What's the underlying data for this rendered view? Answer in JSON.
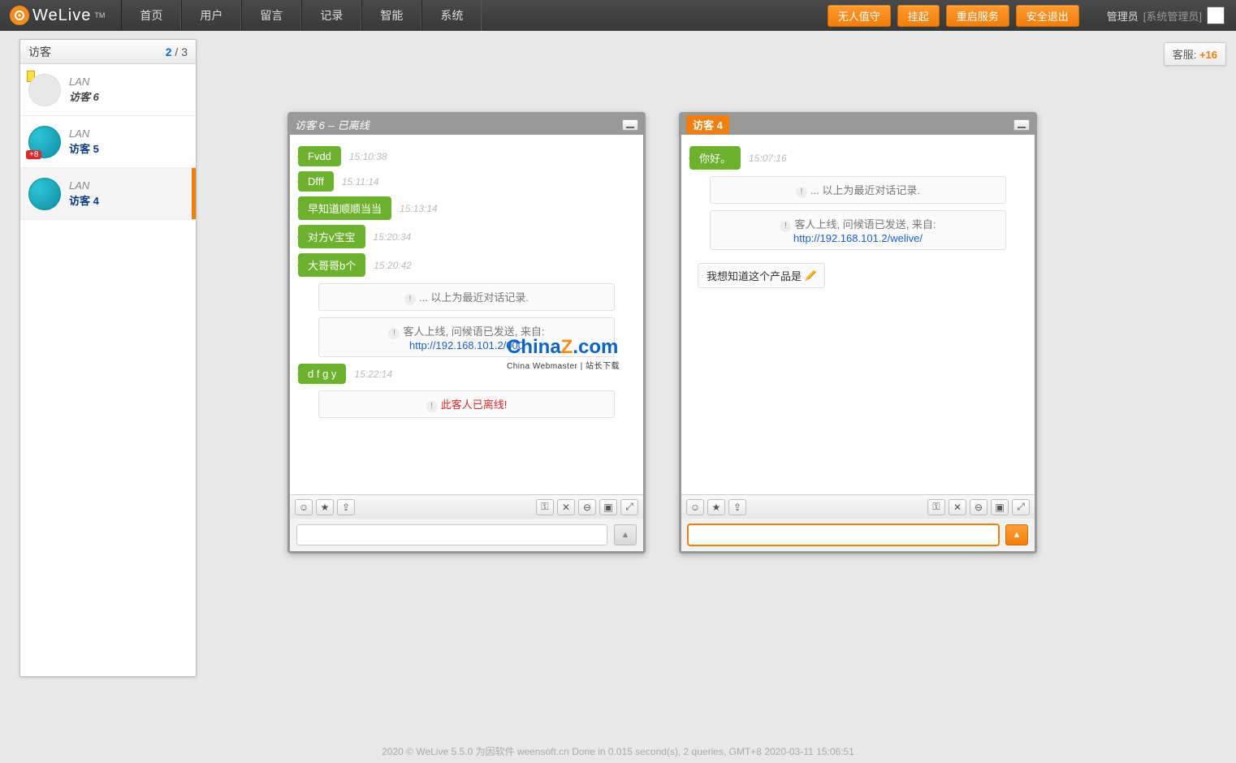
{
  "app": {
    "name": "WeLive",
    "tm": "TM"
  },
  "nav": [
    "首页",
    "用户",
    "留言",
    "记录",
    "智能",
    "系统"
  ],
  "topbtns": [
    "无人值守",
    "挂起",
    "重启服务",
    "安全退出"
  ],
  "user": {
    "name": "管理员",
    "role": "[系统管理员]"
  },
  "badge": {
    "label": "客服:",
    "num": "+16"
  },
  "sidebar": {
    "title": "访客",
    "active": "2",
    "sep": " / ",
    "total": "3",
    "items": [
      {
        "lan": "LAN",
        "name": "访客 6",
        "online": false,
        "unread": "",
        "flag": true
      },
      {
        "lan": "LAN",
        "name": "访客 5",
        "online": true,
        "unread": "+8",
        "flag": false
      },
      {
        "lan": "LAN",
        "name": "访客 4",
        "online": true,
        "unread": "",
        "flag": false
      }
    ]
  },
  "chat1": {
    "title": "访客 6  --  已离线",
    "msgs": [
      {
        "t": "Fvdd",
        "ts": "15:10:38"
      },
      {
        "t": "Dfff",
        "ts": "15:11:14"
      },
      {
        "t": "早知道顺顺当当",
        "ts": "15:13:14"
      },
      {
        "t": "对方v宝宝",
        "ts": "15:20:34"
      },
      {
        "t": "大哥哥b个",
        "ts": "15:20:42"
      }
    ],
    "sys1": "... 以上为最近对话记录.",
    "sys2a": "客人上线, 问候语已发送, 来自:",
    "sys2b": "http://192.168.101.2/000",
    "msg6": {
      "t": "d f g y",
      "ts": "15:22:14"
    },
    "sys3": "此客人已离线!"
  },
  "chat2": {
    "title": "访客 4",
    "msgs": [
      {
        "t": "你好。",
        "ts": "15:07:16"
      }
    ],
    "sys1": "... 以上为最近对话记录.",
    "sys2a": "客人上线, 问候语已发送, 来自:",
    "sys2b": "http://192.168.101.2/welive/",
    "typing": "我想知道这个产品是"
  },
  "footer": "2020 © WeLive 5.5.0 为因软件 weensoft.cn Done in 0.015 second(s), 2 queries, GMT+8 2020-03-11 15:06:51",
  "watermark": {
    "big1": "China",
    "big2": "Z",
    "big3": ".com",
    "sm": "China Webmaster | 站长下载"
  }
}
